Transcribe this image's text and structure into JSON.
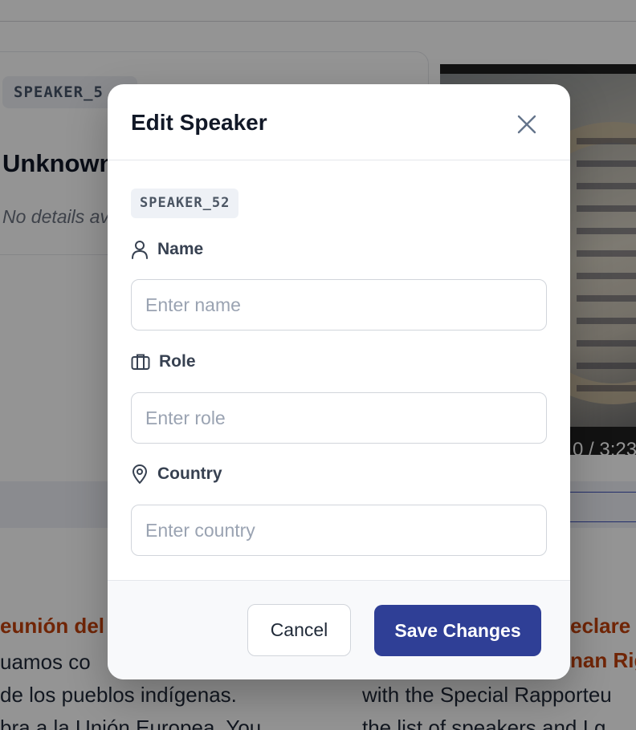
{
  "background": {
    "speaker_card": {
      "badge": "SPEAKER_5",
      "name": "Unknown",
      "details": "No details av"
    },
    "video": {
      "time": "0 / 3:23:"
    },
    "transcript": {
      "left_title": "eunión del",
      "left_lines": [
        "uamos co",
        " de los pueblos indígenas.",
        "bra a la Unión Europea. You"
      ],
      "right_title_1": "eclare ",
      "right_title_2": "nan Rig",
      "right_lines": [
        "with the Special Rapporteu",
        "the list of speakers and I g"
      ]
    }
  },
  "modal": {
    "title": "Edit Speaker",
    "speaker_id": "SPEAKER_52",
    "fields": {
      "name": {
        "label": "Name",
        "placeholder": "Enter name",
        "value": ""
      },
      "role": {
        "label": "Role",
        "placeholder": "Enter role",
        "value": ""
      },
      "country": {
        "label": "Country",
        "placeholder": "Enter country",
        "value": ""
      }
    },
    "buttons": {
      "cancel": "Cancel",
      "save": "Save Changes"
    }
  },
  "colors": {
    "primary": "#2f3f96",
    "accent_text": "#c2410c",
    "overlay": "rgba(0,0,0,0.42)"
  },
  "icons": {
    "close": "close-icon",
    "name": "user-icon",
    "role": "briefcase-icon",
    "country": "map-pin-icon"
  }
}
